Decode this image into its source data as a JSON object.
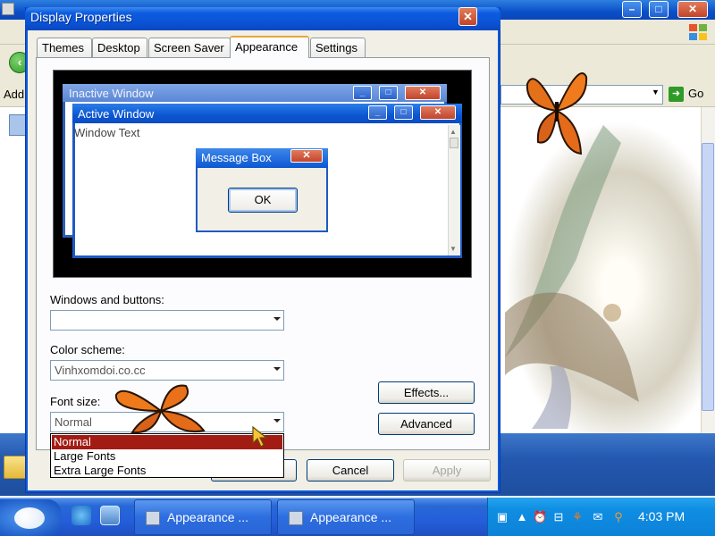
{
  "background_window": {
    "address_label": "Add",
    "go_label": "Go"
  },
  "dialog": {
    "title": "Display Properties",
    "tabs": [
      "Themes",
      "Desktop",
      "Screen Saver",
      "Appearance",
      "Settings"
    ],
    "active_tab": "Appearance",
    "preview": {
      "inactive_window_title": "Inactive Window",
      "active_window_title": "Active Window",
      "window_text": "Window Text",
      "message_box_title": "Message Box",
      "message_box_ok": "OK"
    },
    "windows_and_buttons": {
      "label": "Windows and buttons:",
      "value": ""
    },
    "color_scheme": {
      "label": "Color scheme:",
      "value": "Vinhxomdoi.co.cc"
    },
    "font_size": {
      "label": "Font size:",
      "value": "Normal",
      "options": [
        "Normal",
        "Large Fonts",
        "Extra Large Fonts"
      ],
      "selected_index": 0
    },
    "buttons": {
      "effects": "Effects...",
      "advanced": "Advanced",
      "ok": "",
      "cancel": "Cancel",
      "apply": "Apply"
    }
  },
  "taskbar": {
    "tasks": [
      "Appearance ...",
      "Appearance ..."
    ],
    "clock": "4:03 PM"
  },
  "colors": {
    "xp_blue": "#0a52d4",
    "selection": "#a31c14",
    "tray": "#0f8ee3"
  }
}
